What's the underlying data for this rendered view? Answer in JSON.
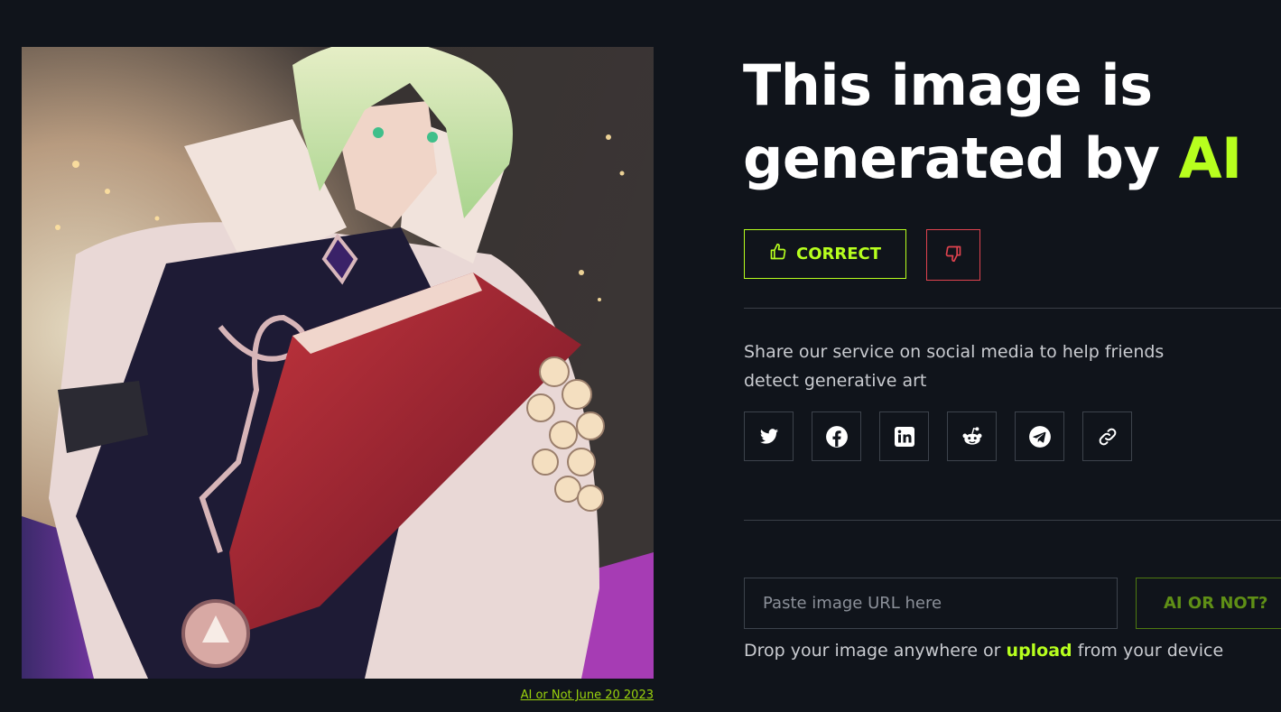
{
  "result": {
    "headline_prefix": "This image is generated by",
    "headline_accent": "AI",
    "accent_color": "#b7ff1e"
  },
  "image": {
    "caption": "AI or Not June 20 2023"
  },
  "feedback": {
    "correct_label": "CORRECT",
    "correct_icon": "thumbs-up-icon",
    "wrong_icon": "thumbs-down-icon"
  },
  "share": {
    "text": "Share our service on social media to help friends detect generative art",
    "icons": [
      "twitter-icon",
      "facebook-icon",
      "linkedin-icon",
      "reddit-icon",
      "telegram-icon",
      "link-icon"
    ]
  },
  "check": {
    "placeholder": "Paste image URL here",
    "button_label": "AI OR NOT?",
    "drop_prefix": "Drop your image anywhere or",
    "upload_link": "upload",
    "drop_suffix": "from your device"
  }
}
